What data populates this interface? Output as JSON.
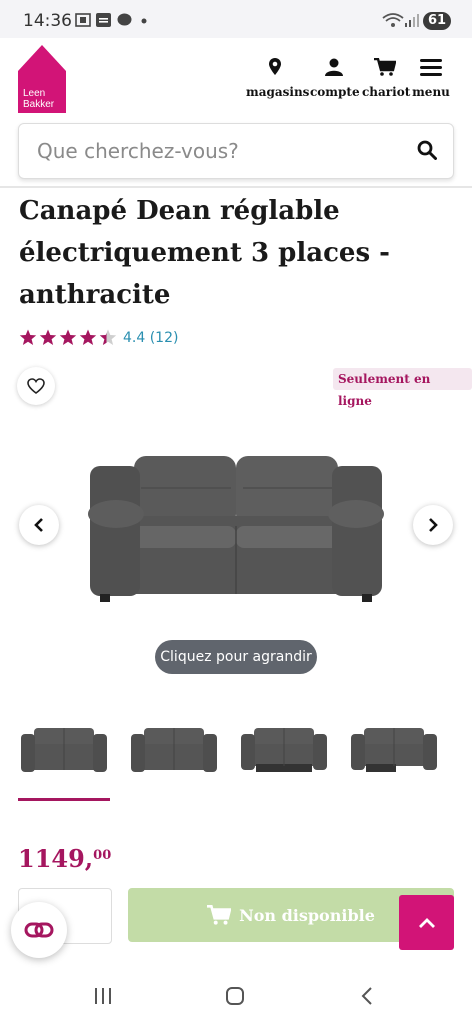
{
  "status_bar": {
    "time": "14:36",
    "battery": "61"
  },
  "header": {
    "logo_text": [
      "Leen",
      "Bakker"
    ],
    "nav": [
      {
        "label": "magasins",
        "icon": "location-pin-icon"
      },
      {
        "label": "compte",
        "icon": "user-icon"
      },
      {
        "label": "chariot",
        "icon": "cart-icon"
      },
      {
        "label": "menu",
        "icon": "hamburger-menu-icon"
      }
    ],
    "search_placeholder": "Que cherchez-vous?"
  },
  "product": {
    "title": "Canapé Dean réglable électriquement 3 places - anthracite",
    "rating": 4.4,
    "rating_text": "4.4 (12)",
    "badge": "Seulement en ligne",
    "zoom_hint": "Cliquez pour agrandir",
    "price_euros": "1149,",
    "price_cents": "00",
    "add_button": "Non disponible"
  },
  "colors": {
    "brand": "#d21477",
    "price": "#a5165f",
    "rating_text": "#2a8fb0",
    "disabled_button": "#c3dca7"
  }
}
